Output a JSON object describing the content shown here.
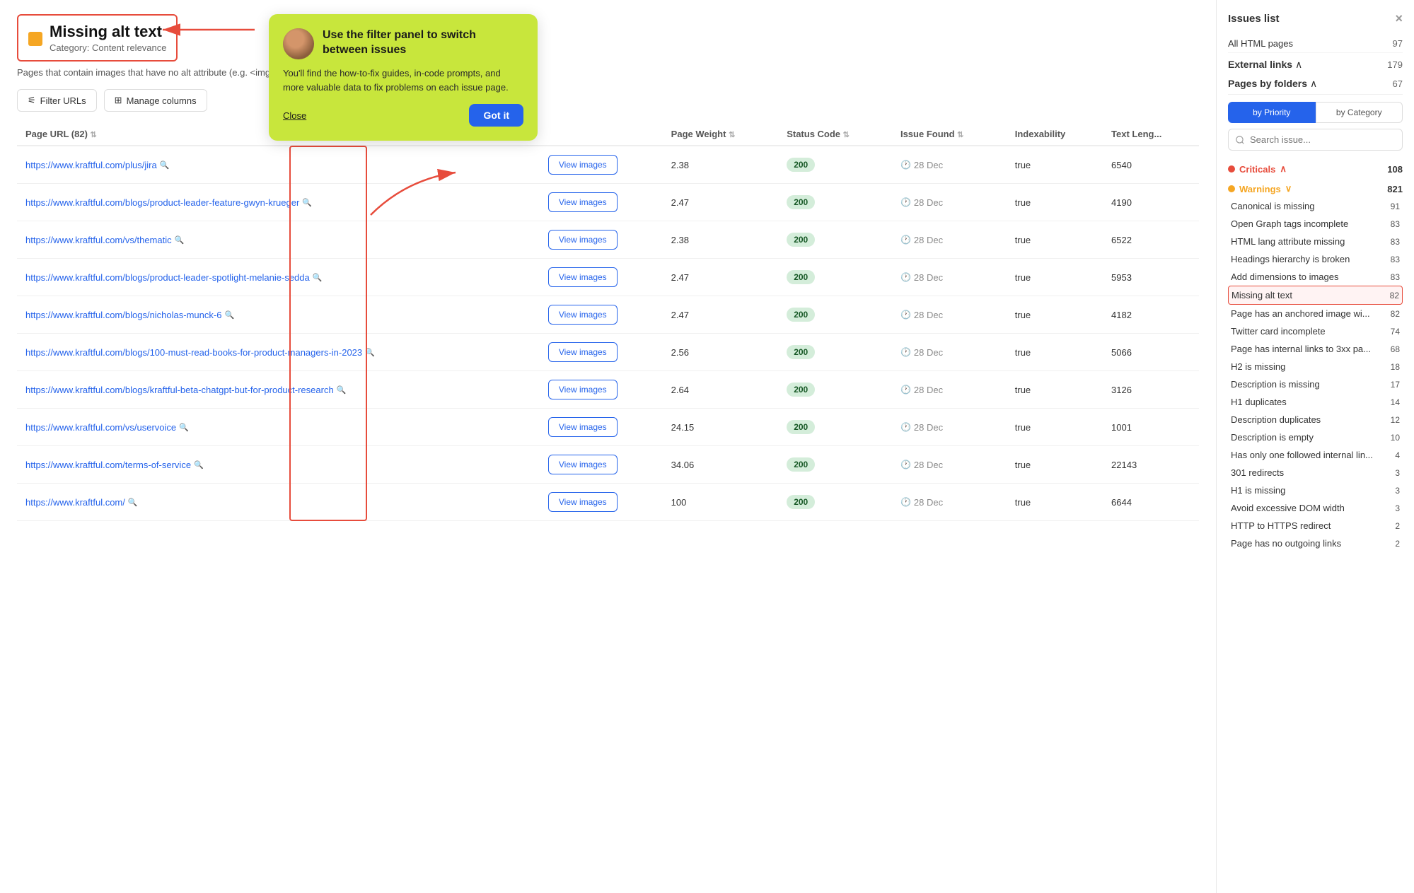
{
  "header": {
    "title": "Missing alt text",
    "category": "Category: Content relevance",
    "description": "Pages that contain images that have no alt attribute (e.g. <img src=\"https://someurl/image/png\" />)",
    "page_count_label": "Page URL (82)"
  },
  "toolbar": {
    "filter_label": "Filter URLs",
    "manage_columns_label": "Manage columns"
  },
  "table": {
    "columns": [
      "Page URL (82)",
      "",
      "Page Weight",
      "Status Code",
      "Issue Found",
      "Indexability",
      "Text Length"
    ],
    "rows": [
      {
        "url": "https://www.kraftful.com/plus/jira",
        "weight": "2.38",
        "status": "200",
        "date": "28 Dec",
        "indexable": "true",
        "text_length": "6540"
      },
      {
        "url": "https://www.kraftful.com/blogs/product-leader-feature-gwyn-krueger",
        "weight": "2.47",
        "status": "200",
        "date": "28 Dec",
        "indexable": "true",
        "text_length": "4190"
      },
      {
        "url": "https://www.kraftful.com/vs/thematic",
        "weight": "2.38",
        "status": "200",
        "date": "28 Dec",
        "indexable": "true",
        "text_length": "6522"
      },
      {
        "url": "https://www.kraftful.com/blogs/product-leader-spotlight-melanie-sedda",
        "weight": "2.47",
        "status": "200",
        "date": "28 Dec",
        "indexable": "true",
        "text_length": "5953"
      },
      {
        "url": "https://www.kraftful.com/blogs/nicholas-munck-6",
        "weight": "2.47",
        "status": "200",
        "date": "28 Dec",
        "indexable": "true",
        "text_length": "4182"
      },
      {
        "url": "https://www.kraftful.com/blogs/100-must-read-books-for-product-managers-in-2023",
        "weight": "2.56",
        "status": "200",
        "date": "28 Dec",
        "indexable": "true",
        "text_length": "5066"
      },
      {
        "url": "https://www.kraftful.com/blogs/kraftful-beta-chatgpt-but-for-product-research",
        "weight": "2.64",
        "status": "200",
        "date": "28 Dec",
        "indexable": "true",
        "text_length": "3126"
      },
      {
        "url": "https://www.kraftful.com/vs/uservoice",
        "weight": "24.15",
        "status": "200",
        "date": "28 Dec",
        "indexable": "true",
        "text_length": "1001"
      },
      {
        "url": "https://www.kraftful.com/terms-of-service",
        "weight": "34.06",
        "status": "200",
        "date": "28 Dec",
        "indexable": "true",
        "text_length": "22143"
      },
      {
        "url": "https://www.kraftful.com/",
        "weight": "100",
        "status": "200",
        "date": "28 Dec",
        "indexable": "true",
        "text_length": "6644"
      }
    ],
    "view_images_label": "View images"
  },
  "tooltip": {
    "title": "Use the filter panel to switch between issues",
    "body": "You'll find the how-to-fix guides, in-code prompts, and more valuable data to fix problems on each issue page.",
    "close_label": "Close",
    "got_it_label": "Got it"
  },
  "sidebar": {
    "title": "Issues list",
    "close_icon": "×",
    "all_html_pages_label": "All HTML pages",
    "all_html_pages_count": "97",
    "external_links_label": "External links",
    "external_links_count": "179",
    "pages_by_folders_label": "Pages by folders",
    "pages_by_folders_count": "67",
    "tabs": [
      "by Priority",
      "by Category"
    ],
    "search_placeholder": "Search issue...",
    "criticals_label": "Criticals",
    "criticals_count": "108",
    "warnings_label": "Warnings",
    "warnings_count": "821",
    "issues": [
      {
        "name": "Canonical is missing",
        "count": "91"
      },
      {
        "name": "Open Graph tags incomplete",
        "count": "83"
      },
      {
        "name": "HTML lang attribute missing",
        "count": "83"
      },
      {
        "name": "Headings hierarchy is broken",
        "count": "83"
      },
      {
        "name": "Add dimensions to images",
        "count": "83"
      },
      {
        "name": "Missing alt text",
        "count": "82",
        "active": true
      },
      {
        "name": "Page has an anchored image wi...",
        "count": "82"
      },
      {
        "name": "Twitter card incomplete",
        "count": "74"
      },
      {
        "name": "Page has internal links to 3xx pa...",
        "count": "68"
      },
      {
        "name": "H2 is missing",
        "count": "18"
      },
      {
        "name": "Description is missing",
        "count": "17"
      },
      {
        "name": "H1 duplicates",
        "count": "14"
      },
      {
        "name": "Description duplicates",
        "count": "12"
      },
      {
        "name": "Description is empty",
        "count": "10"
      },
      {
        "name": "Has only one followed internal lin...",
        "count": "4"
      },
      {
        "name": "301 redirects",
        "count": "3"
      },
      {
        "name": "H1 is missing",
        "count": "3"
      },
      {
        "name": "Avoid excessive DOM width",
        "count": "3"
      },
      {
        "name": "HTTP to HTTPS redirect",
        "count": "2"
      },
      {
        "name": "Page has no outgoing links",
        "count": "2"
      }
    ]
  }
}
